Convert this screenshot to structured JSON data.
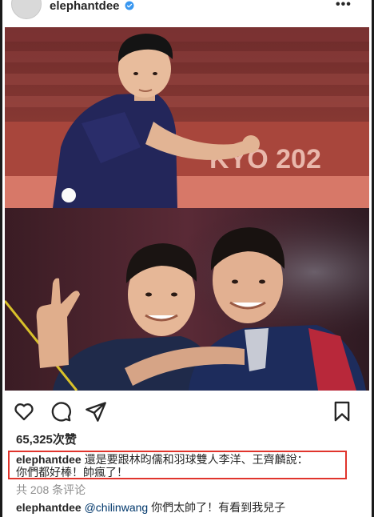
{
  "post": {
    "username": "elephantdee",
    "more_label": "•••",
    "likes": "65,325次赞",
    "caption_user": "elephantdee",
    "caption_text_line1": "還是要跟林昀儒和羽球雙人李洋、王齊麟說：",
    "caption_text_line2": "你們都好棒！帥瘋了！",
    "comments_link": "共 208 条评论",
    "comment": {
      "user": "elephantdee",
      "mention": "@chilinwang",
      "text": "你們太帥了！有看到我兒子"
    },
    "photo_banner_text": "KYO 202"
  },
  "icons": {
    "verified": "verified-badge-icon",
    "like": "heart-icon",
    "comment": "comment-bubble-icon",
    "share": "paper-plane-icon",
    "save": "bookmark-icon"
  },
  "colors": {
    "verified": "#3897f0",
    "highlight_border": "#e0342c",
    "mention": "#00376b",
    "muted": "#8e8e8e"
  }
}
